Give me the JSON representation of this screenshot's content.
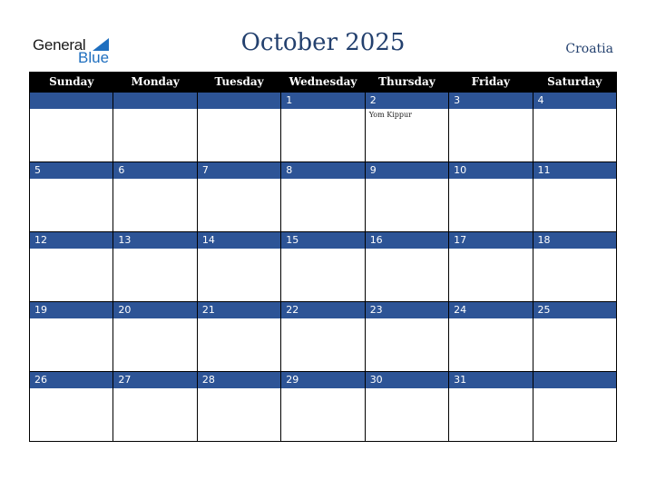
{
  "logo": {
    "general": "General",
    "blue": "Blue",
    "icon": "triangle-flag-icon"
  },
  "header": {
    "title": "October 2025",
    "country": "Croatia"
  },
  "colors": {
    "title": "#23406e",
    "daybar": "#2d5496",
    "header_bg": "#000000",
    "logo_blue": "#1f6fbf"
  },
  "weekdays": [
    "Sunday",
    "Monday",
    "Tuesday",
    "Wednesday",
    "Thursday",
    "Friday",
    "Saturday"
  ],
  "weeks": [
    [
      {
        "day": "",
        "event": ""
      },
      {
        "day": "",
        "event": ""
      },
      {
        "day": "",
        "event": ""
      },
      {
        "day": "1",
        "event": ""
      },
      {
        "day": "2",
        "event": "Yom Kippur"
      },
      {
        "day": "3",
        "event": ""
      },
      {
        "day": "4",
        "event": ""
      }
    ],
    [
      {
        "day": "5",
        "event": ""
      },
      {
        "day": "6",
        "event": ""
      },
      {
        "day": "7",
        "event": ""
      },
      {
        "day": "8",
        "event": ""
      },
      {
        "day": "9",
        "event": ""
      },
      {
        "day": "10",
        "event": ""
      },
      {
        "day": "11",
        "event": ""
      }
    ],
    [
      {
        "day": "12",
        "event": ""
      },
      {
        "day": "13",
        "event": ""
      },
      {
        "day": "14",
        "event": ""
      },
      {
        "day": "15",
        "event": ""
      },
      {
        "day": "16",
        "event": ""
      },
      {
        "day": "17",
        "event": ""
      },
      {
        "day": "18",
        "event": ""
      }
    ],
    [
      {
        "day": "19",
        "event": ""
      },
      {
        "day": "20",
        "event": ""
      },
      {
        "day": "21",
        "event": ""
      },
      {
        "day": "22",
        "event": ""
      },
      {
        "day": "23",
        "event": ""
      },
      {
        "day": "24",
        "event": ""
      },
      {
        "day": "25",
        "event": ""
      }
    ],
    [
      {
        "day": "26",
        "event": ""
      },
      {
        "day": "27",
        "event": ""
      },
      {
        "day": "28",
        "event": ""
      },
      {
        "day": "29",
        "event": ""
      },
      {
        "day": "30",
        "event": ""
      },
      {
        "day": "31",
        "event": ""
      },
      {
        "day": "",
        "event": ""
      }
    ]
  ]
}
